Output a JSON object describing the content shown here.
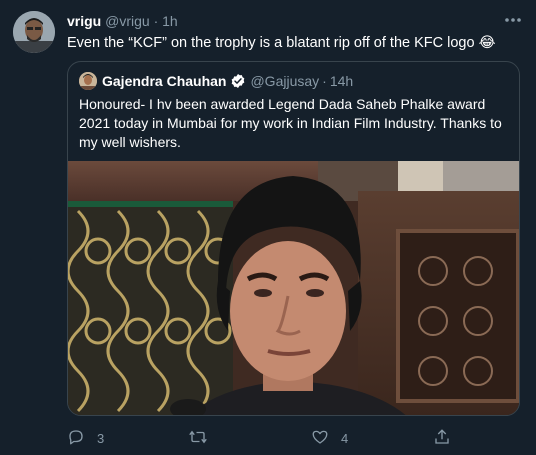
{
  "tweet": {
    "display_name": "vrigu",
    "handle": "@vrigu",
    "separator": "·",
    "time": "1h",
    "text": "Even the “KCF” on the trophy is a blatant rip off of the KFC logo 😂"
  },
  "quoted": {
    "display_name": "Gajendra Chauhan",
    "handle": "@Gajjusay",
    "separator": "·",
    "time": "14h",
    "text": "Honoured- I hv been awarded Legend Dada Saheb Phalke award 2021 today in Mumbai for my work in Indian Film Industry. Thanks to my well wishers."
  },
  "actions": {
    "reply_count": "3",
    "retweet_count": "",
    "like_count": "4"
  },
  "icons": {
    "more": "more-options-icon",
    "verified": "verified-badge-icon",
    "reply": "reply-icon",
    "retweet": "retweet-icon",
    "like": "like-icon",
    "share": "share-icon"
  },
  "colors": {
    "background": "#15202b",
    "muted_text": "#8899a6",
    "border": "#38444d",
    "verified_blue": "#1da1f2"
  }
}
